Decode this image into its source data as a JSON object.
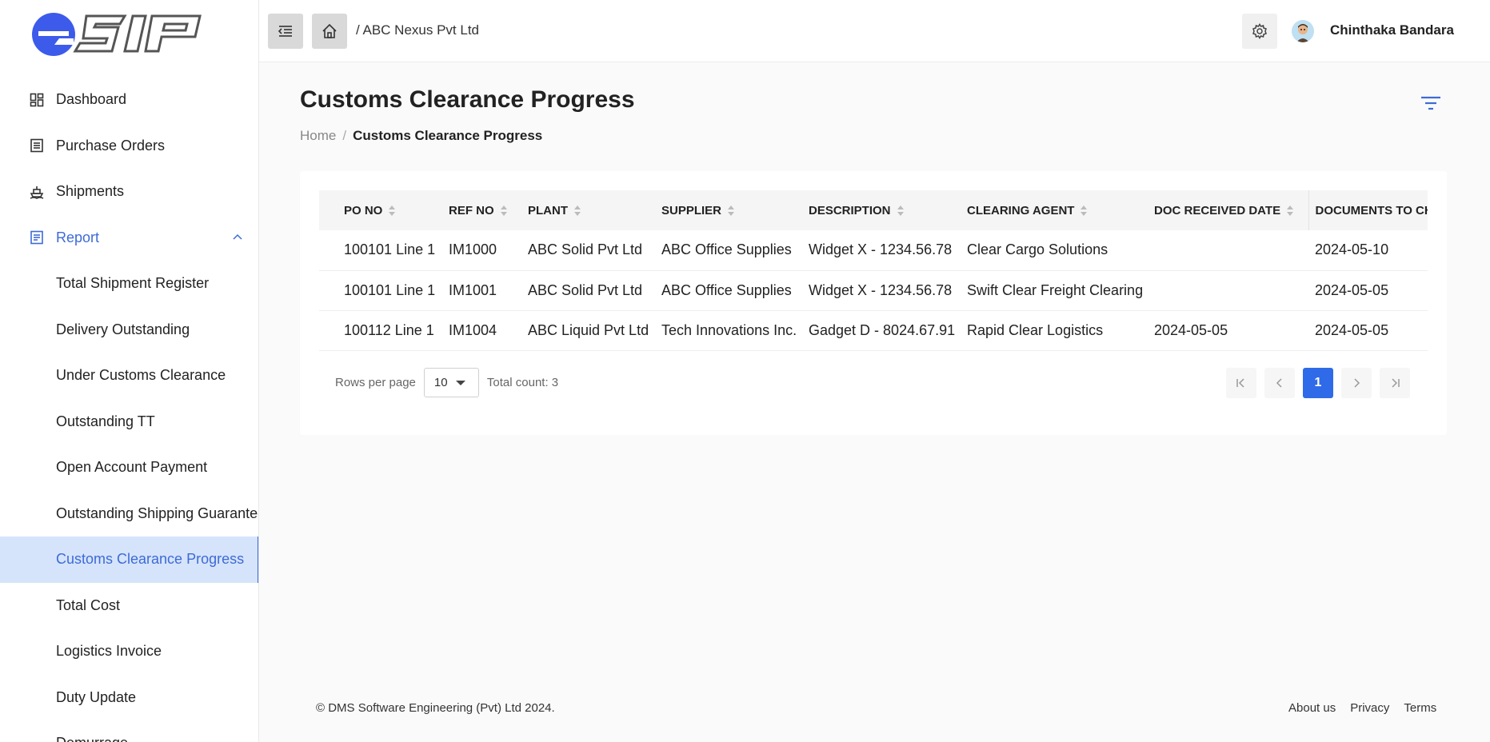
{
  "app": {
    "logo_text": "eSIP",
    "accent": "#3d6bd6",
    "active_bg": "#d6e4fb"
  },
  "header": {
    "company": "/ ABC Nexus Pvt Ltd",
    "user_name": "Chinthaka Bandara",
    "icons": [
      "menu-collapse-icon",
      "home-icon",
      "gear-icon"
    ]
  },
  "sidebar": {
    "items": [
      {
        "label": "Dashboard",
        "icon": "dashboard-icon"
      },
      {
        "label": "Purchase Orders",
        "icon": "document-list-icon"
      },
      {
        "label": "Shipments",
        "icon": "ship-icon"
      },
      {
        "label": "Report",
        "icon": "report-icon",
        "expanded": true
      }
    ],
    "report_items": [
      "Total Shipment Register",
      "Delivery Outstanding",
      "Under Customs Clearance",
      "Outstanding TT",
      "Open Account Payment",
      "Outstanding Shipping Guarantee",
      "Customs Clearance Progress",
      "Total Cost",
      "Logistics Invoice",
      "Duty Update",
      "Demurrage"
    ],
    "active_item": "Customs Clearance Progress"
  },
  "page": {
    "title": "Customs Clearance Progress",
    "breadcrumb_home": "Home",
    "breadcrumb_separator": "/",
    "breadcrumb_current": "Customs Clearance Progress"
  },
  "table": {
    "columns": [
      "PO NO",
      "REF NO",
      "PLANT",
      "SUPPLIER",
      "DESCRIPTION",
      "CLEARING AGENT",
      "DOC RECEIVED DATE",
      "DOCUMENTS TO CH"
    ],
    "rows": [
      [
        "100101 Line 1",
        "IM1000",
        "ABC Solid Pvt Ltd",
        "ABC Office Supplies",
        "Widget X - 1234.56.78",
        "Clear Cargo Solutions",
        "",
        "2024-05-10"
      ],
      [
        "100101 Line 1",
        "IM1001",
        "ABC Solid Pvt Ltd",
        "ABC Office Supplies",
        "Widget X - 1234.56.78",
        "Swift Clear Freight Clearing",
        "",
        "2024-05-05"
      ],
      [
        "100112 Line 1",
        "IM1004",
        "ABC Liquid Pvt Ltd",
        "Tech Innovations Inc.",
        "Gadget D - 8024.67.91",
        "Rapid Clear Logistics",
        "2024-05-05",
        "2024-05-05"
      ]
    ]
  },
  "pagination": {
    "rows_per_page_label": "Rows per page",
    "rows_per_page_value": "10",
    "total_count": "Total count: 3",
    "current_page": "1"
  },
  "footer": {
    "copyright": "© DMS Software Engineering (Pvt) Ltd 2024.",
    "links": [
      "About us",
      "Privacy",
      "Terms"
    ]
  }
}
